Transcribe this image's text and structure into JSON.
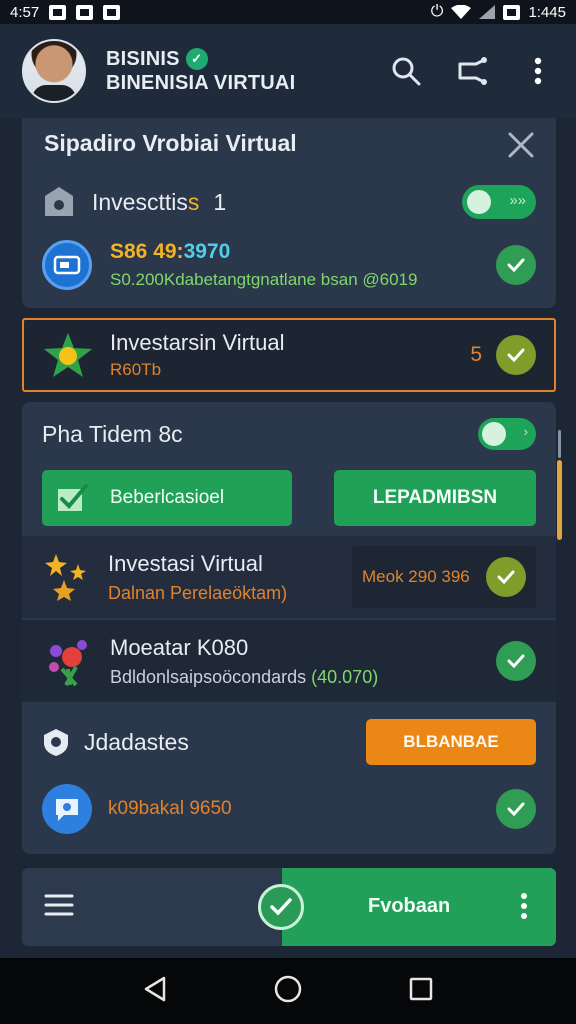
{
  "status_bar": {
    "time_left": "4:57",
    "time_right": "1:445"
  },
  "app_bar": {
    "name_line1": "BISINIS",
    "name_line2": "BINENISIA VIRTUAI"
  },
  "card1": {
    "title": "Sipadiro Vrobiai Virtual",
    "row1_label": "Invescttis",
    "row1_accent": "s",
    "row1_count": "1",
    "row2_amount": "S86 49:",
    "row2_amount_accent": "3970",
    "row2_sub": "S0.200Kdabetangtgnatlane bsan @6019"
  },
  "card2": {
    "title": "Investarsin Virtual",
    "sub": "R60Tb",
    "badge": "5"
  },
  "card3": {
    "title": "Pha Tidem 8c",
    "btn_left": "Beberlcasioel",
    "btn_right": "LEPADMIBSN",
    "item1_title": "Investasi Virtual",
    "item1_sub": "Dalnan Perelaeöktam)",
    "item1_value": "Meok 290 396",
    "item2_title": "Moeatar K080",
    "item2_sub": "Bdldonlsaipsoöcondards",
    "item2_value": "(40.070)",
    "section_title": "Jdadastes",
    "section_btn": "BLBANBAE",
    "item3_sub": "k09bakal 9650"
  },
  "bottom_bar": {
    "action_label": "Fvobaan"
  },
  "colors": {
    "accent_green": "#21a157",
    "accent_orange": "#ea8715",
    "card_bg": "#2b374a",
    "app_bg": "#1c2634"
  }
}
